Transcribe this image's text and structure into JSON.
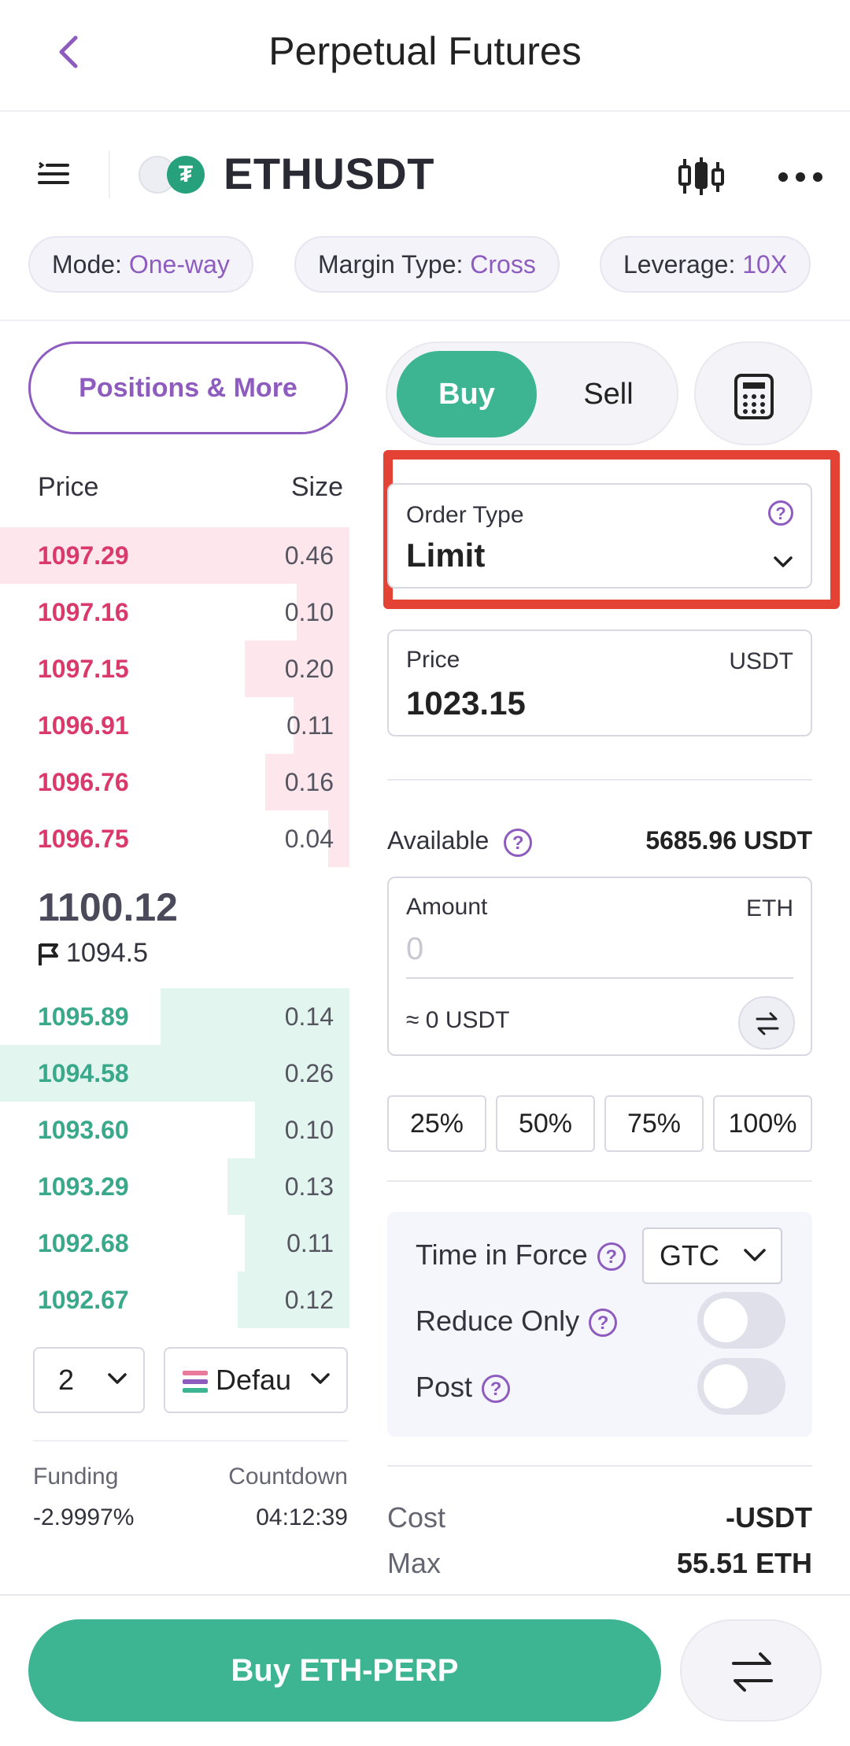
{
  "header": {
    "title": "Perpetual Futures"
  },
  "symbol": {
    "name": "ETHUSDT",
    "coin_glyph": "₮"
  },
  "chips": [
    {
      "label": "Mode: ",
      "value": "One-way"
    },
    {
      "label": "Margin Type: ",
      "value": "Cross"
    },
    {
      "label": "Leverage: ",
      "value": "10X"
    }
  ],
  "positions_button": "Positions & More",
  "orderbook": {
    "price_header": "Price",
    "size_header": "Size",
    "asks": [
      {
        "price": "1097.29",
        "size": "0.46",
        "depth": 1.0
      },
      {
        "price": "1097.16",
        "size": "0.10",
        "depth": 0.15
      },
      {
        "price": "1097.15",
        "size": "0.20",
        "depth": 0.3
      },
      {
        "price": "1096.91",
        "size": "0.11",
        "depth": 0.16
      },
      {
        "price": "1096.76",
        "size": "0.16",
        "depth": 0.24
      },
      {
        "price": "1096.75",
        "size": "0.04",
        "depth": 0.06
      }
    ],
    "last_price": "1100.12",
    "mark_price": "1094.5",
    "bids": [
      {
        "price": "1095.89",
        "size": "0.14",
        "depth": 0.54
      },
      {
        "price": "1094.58",
        "size": "0.26",
        "depth": 1.0
      },
      {
        "price": "1093.60",
        "size": "0.10",
        "depth": 0.27
      },
      {
        "price": "1093.29",
        "size": "0.13",
        "depth": 0.35
      },
      {
        "price": "1092.68",
        "size": "0.11",
        "depth": 0.3
      },
      {
        "price": "1092.67",
        "size": "0.12",
        "depth": 0.32
      }
    ],
    "precision_value": "2",
    "view_value": "Defau"
  },
  "funding": {
    "label": "Funding",
    "value": "-2.9997%",
    "countdown_label": "Countdown",
    "countdown_value": "04:12:39"
  },
  "trade": {
    "buy_label": "Buy",
    "sell_label": "Sell",
    "order_type_label": "Order Type",
    "order_type_value": "Limit",
    "price_label": "Price",
    "price_unit": "USDT",
    "price_value": "1023.15",
    "available_label": "Available",
    "available_value": "5685.96 USDT",
    "amount_label": "Amount",
    "amount_unit": "ETH",
    "amount_placeholder": "0",
    "amount_approx": "≈ 0 USDT",
    "percents": [
      "25%",
      "50%",
      "75%",
      "100%"
    ],
    "time_in_force_label": "Time in Force",
    "time_in_force_value": "GTC",
    "reduce_only_label": "Reduce Only",
    "post_label": "Post",
    "cost_label": "Cost",
    "cost_value": "-USDT",
    "max_label": "Max",
    "max_value": "55.51 ETH"
  },
  "bottom": {
    "buy_button": "Buy ETH-PERP"
  },
  "colors": {
    "accent": "#8e5cbf",
    "buy": "#3db593",
    "ask": "#d93a6b",
    "highlight": "#e34234"
  }
}
